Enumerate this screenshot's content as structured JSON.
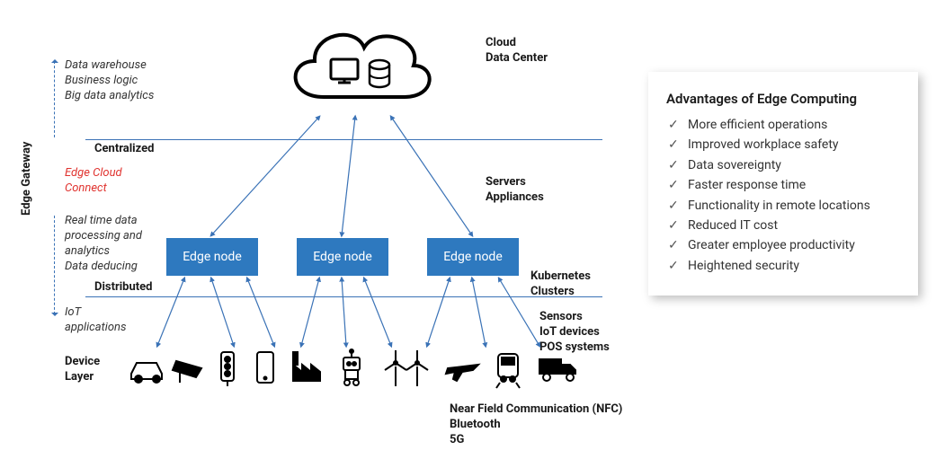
{
  "cloud_label": "Cloud\nData Center",
  "left_axis_label": "Edge Gateway",
  "left_top_list": [
    "Data warehouse",
    "Business logic",
    "Big data analytics"
  ],
  "tier_top": "Centralized",
  "edge_cloud_connect": "Edge Cloud\nConnect",
  "left_mid_list": [
    "Real time data",
    "processing and",
    "analytics",
    "Data deducing"
  ],
  "tier_bottom": "Distributed",
  "iot_apps": "IoT\napplications",
  "device_layer": "Device\nLayer",
  "right_servers": "Servers\nAppliances",
  "right_k8s": "Kubernetes\nClusters",
  "right_sensors": "Sensors\nIoT devices\nPOS systems",
  "bottom_comm": "Near Field Communication (NFC)\nBluetooth\n5G",
  "edge_node_label": "Edge node",
  "advantages_title": "Advantages of Edge Computing",
  "advantages": [
    "More efficient operations",
    "Improved workplace safety",
    "Data sovereignty",
    "Faster response time",
    "Functionality in remote locations",
    "Reduced IT cost",
    "Greater employee productivity",
    "Heightened security"
  ],
  "icons": [
    "car",
    "cctv",
    "traffic-light",
    "smartphone",
    "factory",
    "robot",
    "wind-turbine",
    "airplane",
    "train",
    "truck"
  ],
  "chart_data": {
    "type": "diagram",
    "title": "Edge Computing Architecture",
    "layers": [
      {
        "name": "Cloud Data Center",
        "role": "Centralized",
        "functions": [
          "Data warehouse",
          "Business logic",
          "Big data analytics"
        ],
        "components": [
          "Monitor",
          "Storage"
        ]
      },
      {
        "name": "Edge Gateway",
        "role": "Edge Cloud Connect",
        "components": [
          "Servers",
          "Appliances"
        ]
      },
      {
        "name": "Edge nodes",
        "role": "Distributed",
        "count": 3,
        "functions": [
          "Real time data processing and analytics",
          "Data deducing"
        ],
        "components": [
          "Kubernetes Clusters"
        ]
      },
      {
        "name": "Device Layer",
        "role": "IoT applications",
        "devices": [
          "car",
          "cctv",
          "traffic-light",
          "smartphone",
          "factory",
          "robot",
          "wind-turbine",
          "airplane",
          "train",
          "truck"
        ],
        "components": [
          "Sensors",
          "IoT devices",
          "POS systems"
        ],
        "connectivity": [
          "Near Field Communication (NFC)",
          "Bluetooth",
          "5G"
        ]
      }
    ],
    "sidebar": {
      "title": "Advantages of Edge Computing",
      "items": [
        "More efficient operations",
        "Improved workplace safety",
        "Data sovereignty",
        "Faster response time",
        "Functionality in remote locations",
        "Reduced IT cost",
        "Greater employee productivity",
        "Heightened security"
      ]
    }
  }
}
